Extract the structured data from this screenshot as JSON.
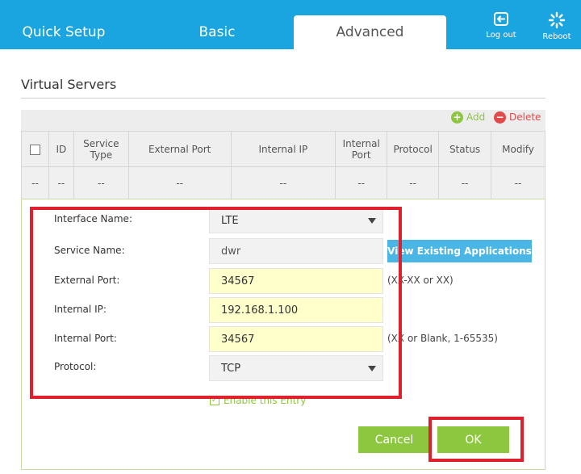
{
  "nav": {
    "tabs": [
      {
        "label": "Quick Setup"
      },
      {
        "label": "Basic"
      },
      {
        "label": "Advanced"
      }
    ],
    "logout_label": "Log out",
    "reboot_label": "Reboot"
  },
  "section": {
    "title": "Virtual Servers",
    "add_label": "Add",
    "delete_label": "Delete"
  },
  "table": {
    "columns": [
      "ID",
      "Service Type",
      "External Port",
      "Internal IP",
      "Internal Port",
      "Protocol",
      "Status",
      "Modify"
    ],
    "row": [
      "--",
      "--",
      "--",
      "--",
      "--",
      "--",
      "--",
      "--",
      "--"
    ]
  },
  "form": {
    "interface_name_label": "Interface Name:",
    "interface_name_value": "LTE",
    "service_name_label": "Service Name:",
    "service_name_value": "dwr",
    "view_apps_label": "View Existing Applications",
    "external_port_label": "External Port:",
    "external_port_value": "34567",
    "external_port_hint": "(XX-XX or XX)",
    "internal_ip_label": "Internal IP:",
    "internal_ip_value": "192.168.1.100",
    "internal_port_label": "Internal Port:",
    "internal_port_value": "34567",
    "internal_port_hint": "(XX or Blank, 1-65535)",
    "protocol_label": "Protocol:",
    "protocol_value": "TCP",
    "enable_label": "Enable this Entry",
    "enable_checked": true,
    "cancel_label": "Cancel",
    "ok_label": "OK"
  },
  "colors": {
    "brand": "#1aa5e0",
    "accent_green": "#8dc63f",
    "delete_red": "#e04a4a",
    "highlight_red": "#e0202c",
    "field_yellow": "#ffffcc"
  }
}
